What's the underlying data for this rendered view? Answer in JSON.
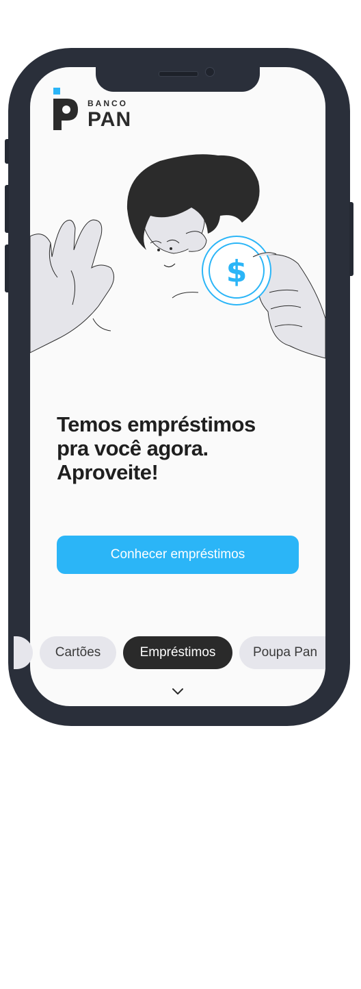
{
  "brand": {
    "line1": "BANCO",
    "line2": "PAN"
  },
  "hero": {
    "headline": "Temos empréstimos pra você agora. Aproveite!"
  },
  "cta": {
    "label": "Conhecer empréstimos"
  },
  "tabs": [
    {
      "label": "Cartões",
      "active": false
    },
    {
      "label": "Empréstimos",
      "active": true
    },
    {
      "label": "Poupa Pan",
      "active": false
    }
  ],
  "colors": {
    "accent": "#2bb5f7",
    "phone_frame": "#2a2f3a",
    "chip_active": "#2a2a2a",
    "chip": "#e6e6ec"
  },
  "icons": {
    "scroll_down": "chevron-down-icon",
    "coin": "dollar-coin-icon"
  }
}
